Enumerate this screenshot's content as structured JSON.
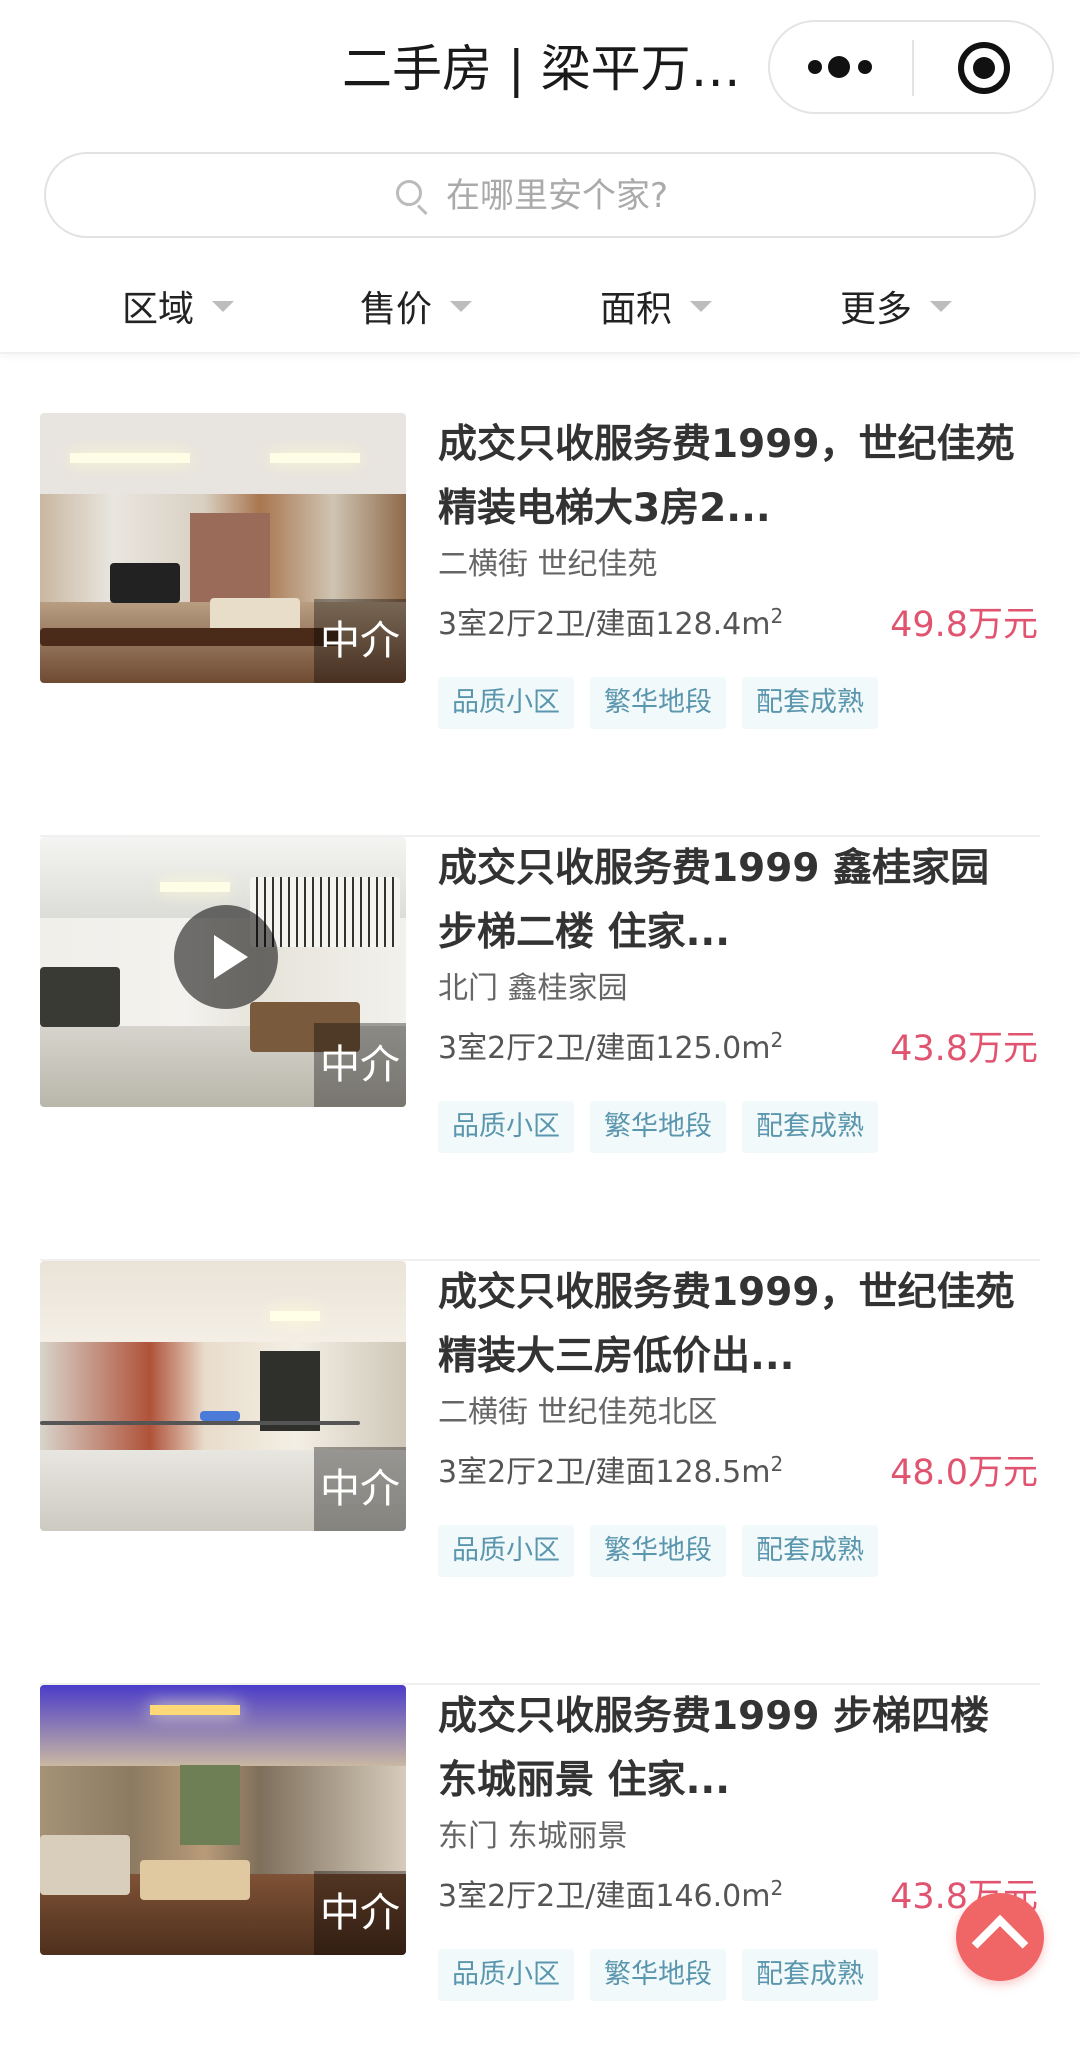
{
  "header": {
    "title": "二手房 | 梁平万…",
    "more_icon": "more-dots-icon",
    "close_icon": "target-circle-icon"
  },
  "search": {
    "placeholder": "在哪里安个家?",
    "value": ""
  },
  "filters": [
    {
      "label": "区域"
    },
    {
      "label": "售价"
    },
    {
      "label": "面积"
    },
    {
      "label": "更多"
    }
  ],
  "listings": [
    {
      "title": "成交只收服务费1999，世纪佳苑精装电梯大3房2...",
      "location": "二横街 世纪佳苑",
      "layout": "3室2厅2卫/建面128.4m",
      "area_unit_sup": "2",
      "price": "49.8万元",
      "badge": "中介",
      "has_video": false,
      "tags": [
        "品质小区",
        "繁华地段",
        "配套成熟"
      ]
    },
    {
      "title": "成交只收服务费1999 鑫桂家园步梯二楼 住家...",
      "location": "北门 鑫桂家园",
      "layout": "3室2厅2卫/建面125.0m",
      "area_unit_sup": "2",
      "price": "43.8万元",
      "badge": "中介",
      "has_video": true,
      "tags": [
        "品质小区",
        "繁华地段",
        "配套成熟"
      ]
    },
    {
      "title": "成交只收服务费1999，世纪佳苑精装大三房低价出...",
      "location": "二横街 世纪佳苑北区",
      "layout": "3室2厅2卫/建面128.5m",
      "area_unit_sup": "2",
      "price": "48.0万元",
      "badge": "中介",
      "has_video": false,
      "tags": [
        "品质小区",
        "繁华地段",
        "配套成熟"
      ]
    },
    {
      "title": "成交只收服务费1999 步梯四楼东城丽景 住家...",
      "location": "东门 东城丽景",
      "layout": "3室2厅2卫/建面146.0m",
      "area_unit_sup": "2",
      "price": "43.8万元",
      "badge": "中介",
      "has_video": false,
      "tags": [
        "品质小区",
        "繁华地段",
        "配套成熟"
      ]
    }
  ],
  "colors": {
    "price": "#e05470",
    "tag_bg": "#f1f9fa",
    "tag_text": "#5a96ad",
    "back_to_top": "#f06666"
  }
}
